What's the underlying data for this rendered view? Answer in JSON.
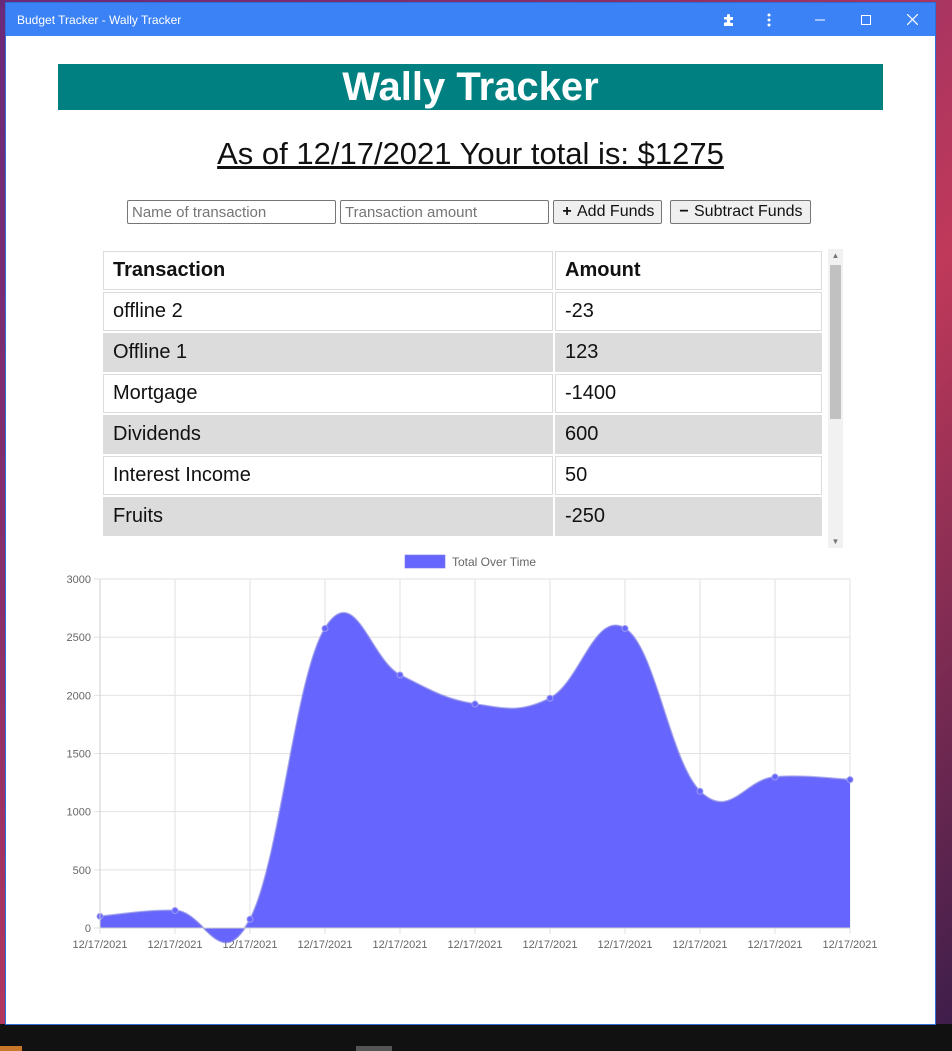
{
  "window": {
    "title": "Budget Tracker - Wally Tracker",
    "extensions_icon": "puzzle-icon",
    "menu_icon": "kebab-menu-icon",
    "minimize_icon": "minimize-icon",
    "maximize_icon": "maximize-icon",
    "close_icon": "close-icon"
  },
  "app": {
    "title": "Wally Tracker",
    "total_text": "As of 12/17/2021 Your total is: $1275"
  },
  "form": {
    "name_placeholder": "Name of transaction",
    "amount_placeholder": "Transaction amount",
    "add_label": "Add Funds",
    "subtract_label": "Subtract Funds",
    "add_icon": "plus-icon",
    "subtract_icon": "minus-icon"
  },
  "table": {
    "headers": [
      "Transaction",
      "Amount"
    ],
    "rows": [
      {
        "name": "offline 2",
        "amount": "-23"
      },
      {
        "name": "Offline 1",
        "amount": "123"
      },
      {
        "name": "Mortgage",
        "amount": "-1400"
      },
      {
        "name": "Dividends",
        "amount": "600"
      },
      {
        "name": "Interest Income",
        "amount": "50"
      },
      {
        "name": "Fruits",
        "amount": "-250"
      }
    ]
  },
  "chart_data": {
    "type": "area",
    "x": [
      "12/17/2021",
      "12/17/2021",
      "12/17/2021",
      "12/17/2021",
      "12/17/2021",
      "12/17/2021",
      "12/17/2021",
      "12/17/2021",
      "12/17/2021",
      "12/17/2021",
      "12/17/2021"
    ],
    "series": [
      {
        "name": "Total Over Time",
        "values": [
          100,
          150,
          75,
          2575,
          2175,
          1925,
          1975,
          2575,
          1175,
          1298,
          1275
        ],
        "color": "#6666ff"
      }
    ],
    "ylim": [
      0,
      3000
    ],
    "yticks": [
      0,
      500,
      1000,
      1500,
      2000,
      2500,
      3000
    ],
    "grid": true,
    "legend": "top-center"
  }
}
